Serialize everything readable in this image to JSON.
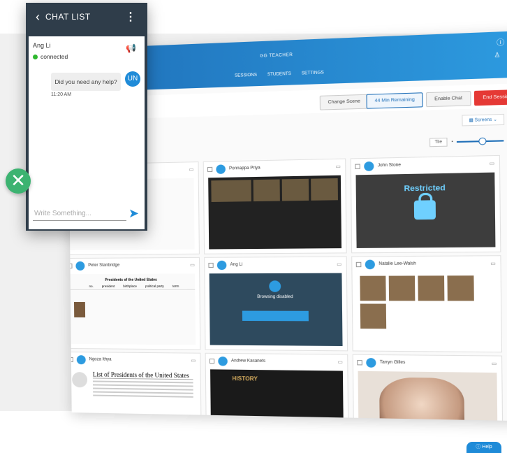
{
  "chat": {
    "title": "CHAT LIST",
    "contact_name": "Ang Li",
    "status": "connected",
    "message": "Did you need any help?",
    "avatar_initials": "UN",
    "time": "11:20 AM",
    "input_placeholder": "Write Something..."
  },
  "dashboard": {
    "app_title": "GG TEACHER",
    "nav": [
      "SESSIONS",
      "STUDENTS",
      "SETTINGS"
    ],
    "buttons": {
      "change_scene": "Change Scene",
      "remaining": "44 Min Remaining",
      "enable_chat": "Enable Chat",
      "end_session": "End Session"
    },
    "screens_label": "Screens",
    "tile_label": "Tile",
    "restricted_title": "Restricted",
    "browsing_disabled": "Browsing disabled",
    "wiki_title": "List of Presidents of the United States",
    "table_title": "Presidents of the United States",
    "table_headers": [
      "no.",
      "president",
      "birthplace",
      "political party",
      "term"
    ],
    "history_logo": "HISTORY",
    "students": [
      "Ponnappa Priya",
      "John Stone",
      "Peter Stanbridge",
      "Ang Li",
      "Natalie Lee-Walsh",
      "Ngoza Ithya",
      "Andrew Kasanets",
      "Tarryn Gilles"
    ]
  },
  "help_label": "Help",
  "colors": {
    "accent": "#1f8bd8",
    "close": "#3cb371",
    "end": "#e53935",
    "chat_bg": "#2f3d4a"
  }
}
